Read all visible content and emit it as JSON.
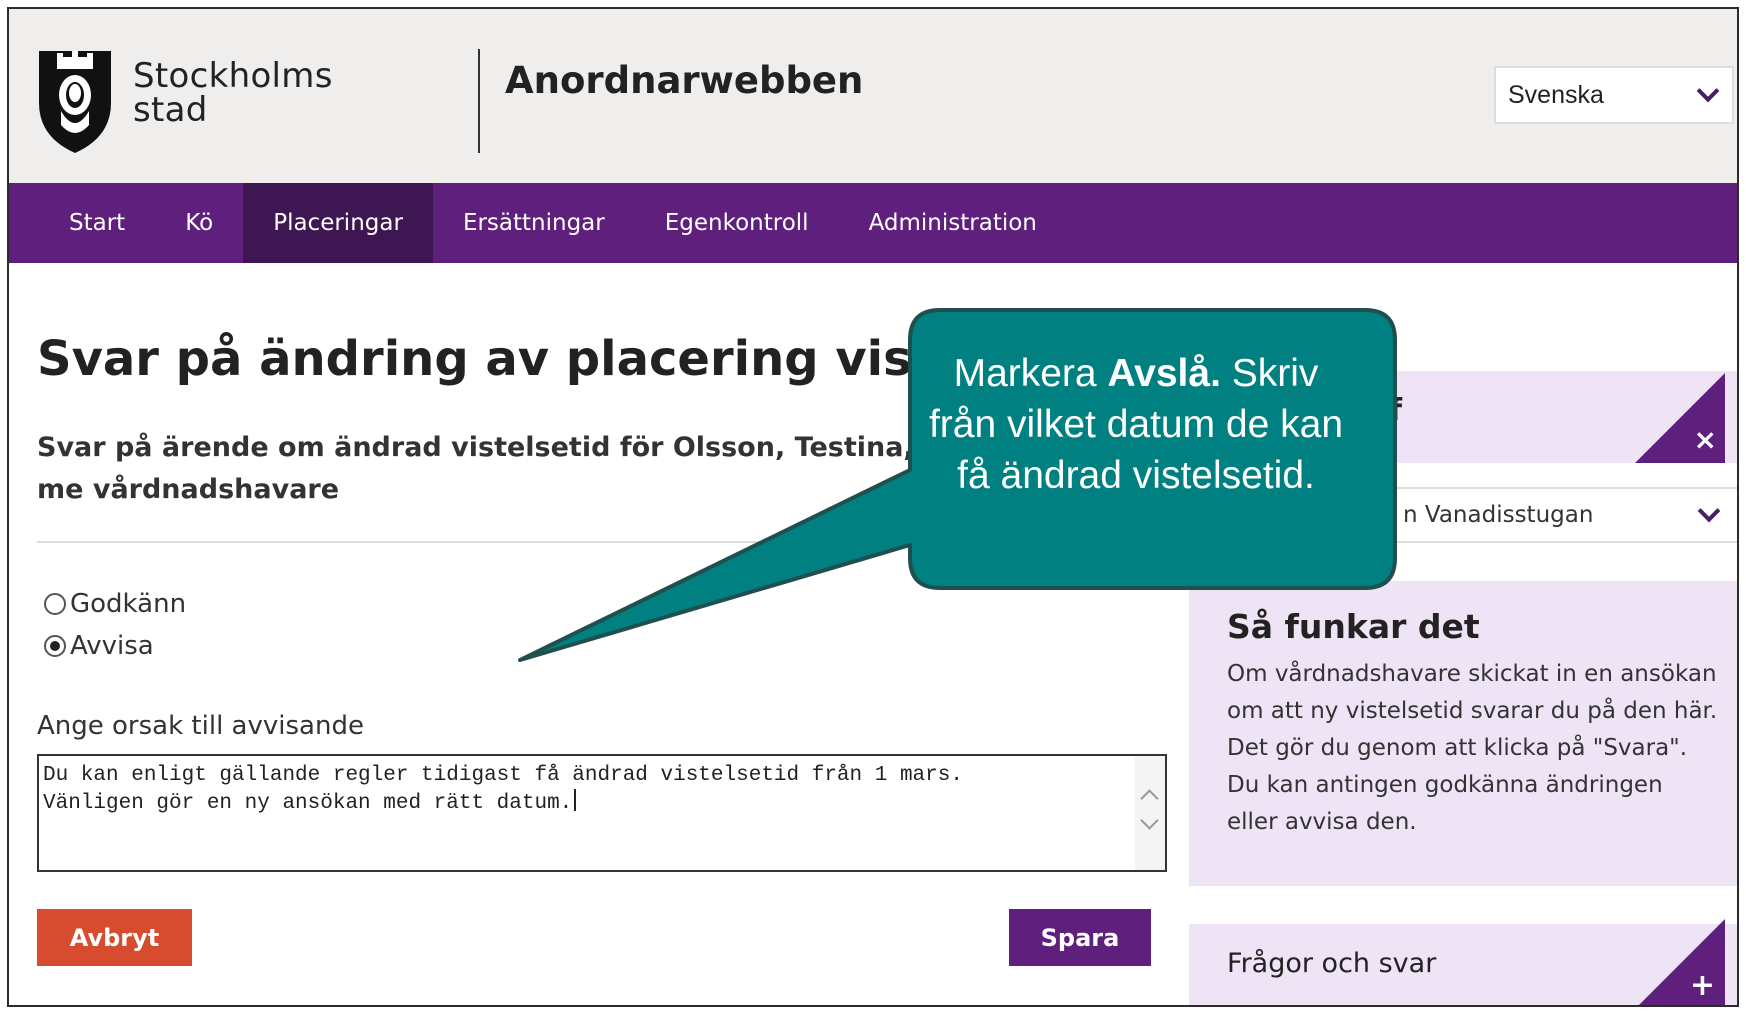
{
  "header": {
    "logo_line1": "Stockholms",
    "logo_line2": "stad",
    "app_title": "Anordnarwebben",
    "language": "Svenska"
  },
  "nav": {
    "items": [
      {
        "label": "Start",
        "active": false
      },
      {
        "label": "Kö",
        "active": false
      },
      {
        "label": "Placeringar",
        "active": true
      },
      {
        "label": "Ersättningar",
        "active": false
      },
      {
        "label": "Egenkontroll",
        "active": false
      },
      {
        "label": "Administration",
        "active": false
      }
    ]
  },
  "main": {
    "title": "Svar på ändring av placering vistelset",
    "subtitle": "Svar på ärende om ändrad vistelsetid för Olsson, Testina, me vårdnadshavare",
    "options": {
      "approve_label": "Godkänn",
      "reject_label": "Avvisa",
      "selected": "Avvisa"
    },
    "reason_label": "Ange orsak till avvisande",
    "reason_line1": "Du kan enligt gällande regler tidigast få ändrad vistelsetid från 1 mars.",
    "reason_line2": "Vänligen gör en ny ansökan med rätt datum.",
    "cancel_label": "Avbryt",
    "save_label": "Spara"
  },
  "sidebar": {
    "top_box_fragment": "f",
    "close_icon": "×",
    "unit_value": "n Vanadisstugan",
    "howto_title": "Så funkar det",
    "howto_text": "Om vårdnadshavare skickat in en ansökan om att ny vistelsetid svarar du på den här. Det gör du genom att klicka på \"Svara\". Du kan antingen godkänna ändringen eller avvisa den.",
    "faq_label": "Frågor och svar",
    "faq_icon": "+"
  },
  "callout": {
    "part1": "Markera ",
    "bold": "Avslå.",
    "part2": " Skriv från vilket datum de kan få ändrad vistelsetid."
  },
  "colors": {
    "brand_purple": "#5f1f7c",
    "nav_active": "#3d1652",
    "cancel_red": "#d74b2f",
    "callout_teal": "#008080",
    "sidebar_bg": "#efe3f6"
  }
}
